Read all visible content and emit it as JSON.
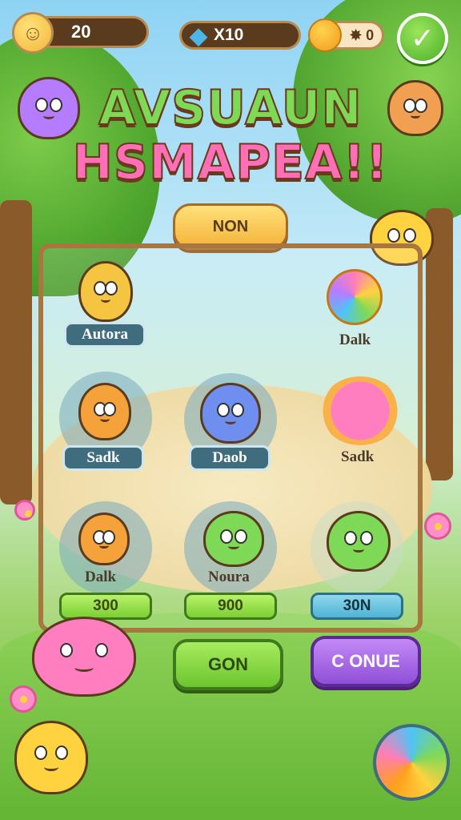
{
  "hud": {
    "coins": "20",
    "gems": "X10",
    "stars": "0"
  },
  "title": {
    "line1": "AVSUAUN",
    "line2": "HSMAPEA!!"
  },
  "tab_label": "NON",
  "creatures": [
    {
      "name": "Autora",
      "style": "pill"
    },
    {
      "name": "Dalk",
      "style": "plain"
    },
    {
      "name": "Sadk",
      "style": "pill"
    },
    {
      "name": "Daob",
      "style": "pill"
    },
    {
      "name": "Sadk",
      "style": "plain"
    },
    {
      "name": "Dalk",
      "style": "plain"
    },
    {
      "name": "Noura",
      "style": "plain"
    }
  ],
  "prices": [
    "300",
    "900",
    "30N"
  ],
  "buttons": {
    "go": "GON",
    "continue": "C ONUE"
  },
  "colors": {
    "accent_green": "#7ccf33",
    "accent_purple": "#8f4fd8",
    "wood": "#a8773f"
  }
}
